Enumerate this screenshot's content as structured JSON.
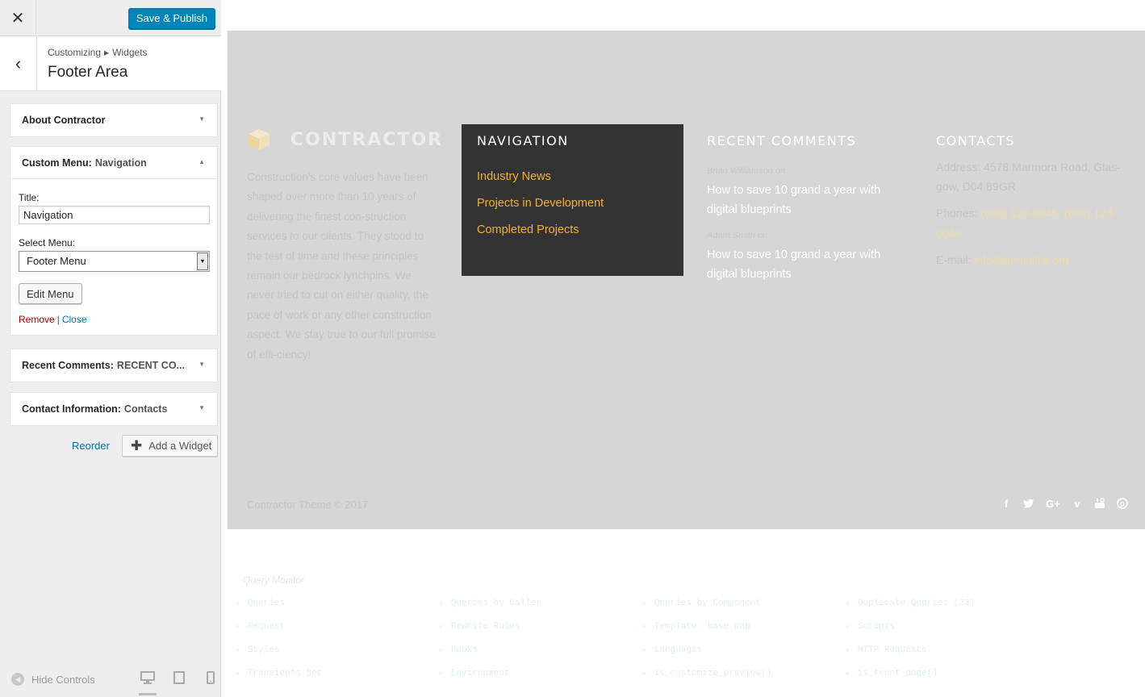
{
  "header": {
    "close_icon": "close-icon",
    "publish_label": "Save & Publish",
    "accent_color": "#0085ba"
  },
  "section": {
    "crumb_root": "Customizing",
    "crumb_section": "Widgets",
    "title": "Footer Area"
  },
  "widgets": [
    {
      "name": "About Contractor",
      "sub": ""
    },
    {
      "name": "Custom Menu:",
      "sub": "Navigation"
    },
    {
      "name": "Recent Comments:",
      "sub": "RECENT CO..."
    },
    {
      "name": "Contact Information:",
      "sub": "Contacts"
    }
  ],
  "menu_form": {
    "title_label": "Title:",
    "title_value": "Navigation",
    "select_label": "Select Menu:",
    "select_value": "Footer Menu",
    "edit_label": "Edit Menu",
    "remove_label": "Remove",
    "separator": "|",
    "close_label": "Close"
  },
  "sidebar_actions": {
    "reorder_label": "Reorder",
    "add_widget_label": "Add a Widget"
  },
  "sidebar_footer": {
    "hide_controls_label": "Hide Controls",
    "devices": [
      "desktop-icon",
      "tablet-icon",
      "mobile-icon"
    ],
    "active_device": "desktop"
  },
  "site_footer": {
    "brand": "CONTRACTOR",
    "about": "Construction's core values have been shaped over more than 10 years of delivering the finest con-struction services to our clients. They stood to the test of time and these principles remain our bedrock lynchpins. We never tried to cut on either quality, the pace of work or any other construction aspect. We stay true to our full promise of effi-ciency!",
    "nav_title": "NAVIGATION",
    "nav_links": [
      "Industry News",
      "Projects in Development",
      "Completed Projects"
    ],
    "comments_title": "RECENT COMMENTS",
    "comments": [
      {
        "author": "Brian Williamson on",
        "text": "How to save 10 grand a year with digital blueprints"
      },
      {
        "author": "Adam Smith on",
        "text": "How to save 10 grand a year with digital blueprints"
      }
    ],
    "contacts_title": "CONTACTS",
    "address": "Address: 4578 Marmora Road, Glas-gow, D04 89GR",
    "phones_label": "Phones:",
    "phones_value": "(800) 123-0045, (800) 123-0046",
    "email_label": "E-mail:",
    "email_value": "info@demolink.org",
    "copyright": "Contractor Theme © 2017",
    "social_icons": [
      "facebook-icon",
      "twitter-icon",
      "google-plus-icon",
      "vimeo-icon",
      "youtube-icon",
      "pinterest-icon"
    ],
    "nav_link_color": "#f2b134",
    "nav_box_color": "#333333",
    "footer_bg_color": "#d6d6d6"
  },
  "query_monitor": {
    "title": "Query Monitor",
    "items": [
      "Queries",
      "Queries by Caller",
      "Queries by Component",
      "Duplicate Queries (23)",
      "Request",
      "Rewrite Rules",
      "Template: base.php",
      "Scripts",
      "Styles",
      "Hooks",
      "Languages",
      "HTTP Requests",
      "Transients Set",
      "Environment",
      "is_customize_preview()",
      "is_front_page()"
    ]
  }
}
